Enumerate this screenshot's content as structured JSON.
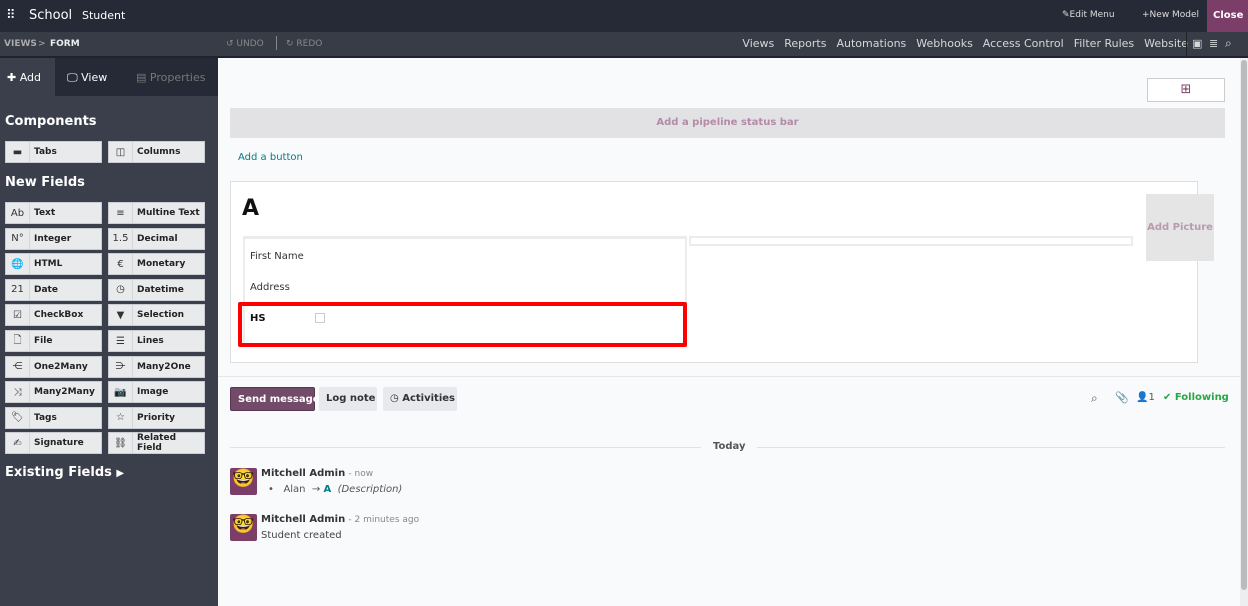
{
  "topbar": {
    "app": "School",
    "menu": "Student",
    "edit_menu": "Edit Menu",
    "new_model": "New Model",
    "close": "Close"
  },
  "subbar": {
    "breadcrumb_views": "VIEWS",
    "breadcrumb_sep": ">",
    "breadcrumb_form": "FORM",
    "undo": "UNDO",
    "redo": "REDO",
    "nav": [
      "Views",
      "Reports",
      "Automations",
      "Webhooks",
      "Access Control",
      "Filter Rules",
      "Website"
    ]
  },
  "sidebar": {
    "tabs": {
      "add": "Add",
      "view": "View",
      "properties": "Properties"
    },
    "components_title": "Components",
    "components": [
      {
        "icon": "tabs-icon",
        "g": "▬",
        "label": "Tabs"
      },
      {
        "icon": "columns-icon",
        "g": "◫",
        "label": "Columns"
      }
    ],
    "new_fields_title": "New Fields",
    "fields": [
      {
        "icon": "text-icon",
        "g": "Ab",
        "label": "Text"
      },
      {
        "icon": "multiline-icon",
        "g": "≡",
        "label": "Multine Text"
      },
      {
        "icon": "integer-icon",
        "g": "N°",
        "label": "Integer"
      },
      {
        "icon": "decimal-icon",
        "g": "1.5",
        "label": "Decimal"
      },
      {
        "icon": "globe-icon",
        "g": "🌐",
        "label": "HTML"
      },
      {
        "icon": "euro-icon",
        "g": "€",
        "label": "Monetary"
      },
      {
        "icon": "calendar-icon",
        "g": "21",
        "label": "Date"
      },
      {
        "icon": "clock-icon",
        "g": "◷",
        "label": "Datetime"
      },
      {
        "icon": "checkbox-icon",
        "g": "☑",
        "label": "CheckBox"
      },
      {
        "icon": "caret-down-icon",
        "g": "▼",
        "label": "Selection"
      },
      {
        "icon": "file-icon",
        "g": "🗋",
        "label": "File"
      },
      {
        "icon": "list-icon",
        "g": "☰",
        "label": "Lines"
      },
      {
        "icon": "one2many-icon",
        "g": "⋲",
        "label": "One2Many"
      },
      {
        "icon": "many2one-icon",
        "g": "⋺",
        "label": "Many2One"
      },
      {
        "icon": "many2many-icon",
        "g": "⤨",
        "label": "Many2Many"
      },
      {
        "icon": "camera-icon",
        "g": "📷",
        "label": "Image"
      },
      {
        "icon": "tag-icon",
        "g": "🏷",
        "label": "Tags"
      },
      {
        "icon": "star-icon",
        "g": "☆",
        "label": "Priority"
      },
      {
        "icon": "signature-icon",
        "g": "✍",
        "label": "Signature"
      },
      {
        "icon": "link-icon",
        "g": "⛓",
        "label": "Related Field"
      }
    ],
    "existing_fields": "Existing Fields"
  },
  "form": {
    "pipeline": "Add a pipeline status bar",
    "add_button": "Add a button",
    "name": "A",
    "add_picture": "Add Picture",
    "fields": {
      "first_name": "First Name",
      "address": "Address",
      "hs": "HS"
    }
  },
  "chatter": {
    "send": "Send message",
    "log": "Log note",
    "activities": "Activities",
    "followers": "1",
    "following": "Following",
    "today": "Today",
    "messages": [
      {
        "author": "Mitchell Admin",
        "time": "- now",
        "old": "Alan",
        "arrow": "→",
        "new": "A",
        "field": "(Description)"
      },
      {
        "author": "Mitchell Admin",
        "time": "- 2 minutes ago",
        "body": "Student created"
      }
    ]
  }
}
